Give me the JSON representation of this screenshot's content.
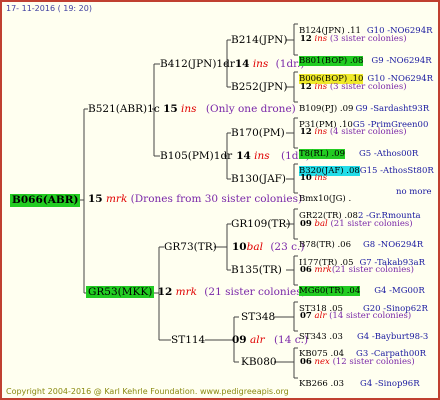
{
  "header": {
    "date": "17- 11-2016 ( 19: 20)"
  },
  "footer": {
    "copyright": "Copyright 2004-2016 @ Karl Kehrle Foundation.   www.pedigreeapis.org"
  },
  "colors": {
    "border": "#c04030",
    "highlight_green": "#22cc22",
    "highlight_yellow": "#f0ea2a",
    "highlight_cyan": "#22dde8",
    "mark_red": "#e00000",
    "sister_purple": "#7a28a8",
    "line_blue": "#1a1aa0"
  },
  "root": {
    "name": "B066(ABR)",
    "count": "15",
    "mark": "mrk",
    "note": "(Drones from 30 sister colonies)"
  },
  "gen2": [
    {
      "name": "B521(ABR)1c",
      "count": "15",
      "mark": "ins",
      "note": "(Only one drone)"
    },
    {
      "name": "GR53(MKK)",
      "count": "12",
      "mark": "mrk",
      "note": "(21 sister colonies)"
    }
  ],
  "gen3": [
    {
      "name": "B412(JPN)1dr",
      "count": "14",
      "mark": "ins",
      "note": "(1dr.)"
    },
    {
      "name": "B105(PM)1dr",
      "count": "14",
      "mark": "ins",
      "note": "(1dr.)"
    },
    {
      "name": "GR73(TR)",
      "count": "10",
      "mark": "bal",
      "note": "(23 c.)"
    },
    {
      "name": "ST114",
      "count": "09",
      "mark": "alr",
      "note": "(14 c.)"
    }
  ],
  "gen4": [
    "B214(JPN)",
    "B252(JPN)",
    "B170(PM)",
    "B130(JAF)",
    "GR109(TR)",
    "B135(TR)",
    "ST348",
    "KB080"
  ],
  "gen5": [
    {
      "sire": "B124(JPN) .11",
      "code": "G10 -NO6294R"
    },
    {
      "count": "12",
      "mark": "ins",
      "note": "(3 sister colonies)"
    },
    {
      "sire": "B801(BOP) .08",
      "code": "G9 -NO6294R"
    },
    {
      "sire": "B006(BOP) .10",
      "code": "G10 -NO6294R"
    },
    {
      "count": "12",
      "mark": "ins",
      "note": "(3 sister colonies)"
    },
    {
      "sire": "B109(PJ) .09",
      "code": "G9 -Sardasht93R"
    },
    {
      "sire": "P31(PM) .10",
      "code": "G5 -PrimGreen00"
    },
    {
      "count": "12",
      "mark": "ins",
      "note": "(4 sister colonies)"
    },
    {
      "sire": "T8(RL) .09",
      "code": "G5 -Athos00R"
    },
    {
      "sire": "B320(JAF) .08",
      "code": "G15 -AthosSt80R"
    },
    {
      "count": "10",
      "mark": "ins",
      "note": ""
    },
    {
      "sire": "Bmx10(JG) .",
      "code": "no more"
    },
    {
      "sire": "GR22(TR) .08",
      "code": "2 -Gr.Rmounta"
    },
    {
      "count": "09",
      "mark": "bal",
      "note": "(21 sister colonies)"
    },
    {
      "sire": "B78(TR) .06",
      "code": "G8 -NO6294R"
    },
    {
      "sire": "I177(TR) .05",
      "code": "G7 -Takab93aR"
    },
    {
      "count": "06",
      "mark": "mrk",
      "note": "(21 sister colonies)"
    },
    {
      "sire": "MG60(TR) .04",
      "code": "G4 -MG00R"
    },
    {
      "sire": "ST318 .05",
      "code": "G20 -Sinop62R"
    },
    {
      "count": "07",
      "mark": "alr",
      "note": "(14 sister colonies)"
    },
    {
      "sire": "ST343 .03",
      "code": "G4 -Bayburt98-3"
    },
    {
      "sire": "KB075 .04",
      "code": "G3 -Carpath00R"
    },
    {
      "count": "06",
      "mark": "nex",
      "note": "(12 sister colonies)"
    },
    {
      "sire": "KB266 .03",
      "code": "G4 -Sinop96R"
    }
  ]
}
